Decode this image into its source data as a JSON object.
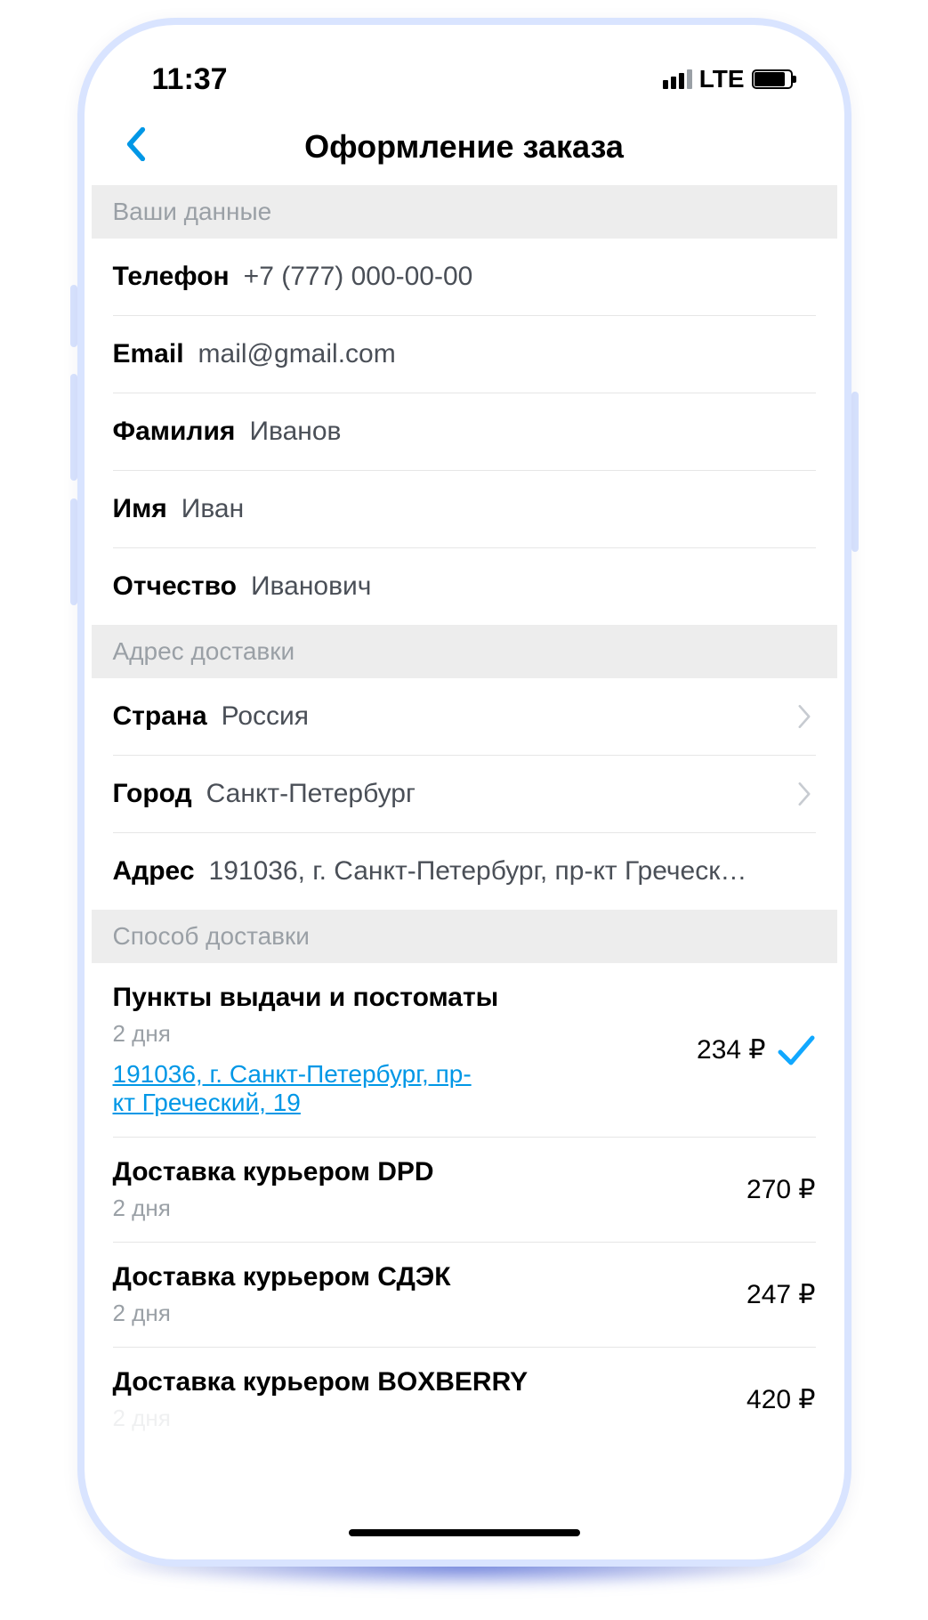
{
  "status": {
    "time": "11:37",
    "network": "LTE"
  },
  "nav": {
    "title": "Оформление заказа"
  },
  "sections": {
    "personal_header": "Ваши данные",
    "address_header": "Адрес доставки",
    "delivery_header": "Способ доставки"
  },
  "personal": {
    "phone_label": "Телефон",
    "phone_value": "+7 (777) 000-00-00",
    "email_label": "Email",
    "email_value": "mail@gmail.com",
    "last_label": "Фамилия",
    "last_value": "Иванов",
    "first_label": "Имя",
    "first_value": "Иван",
    "patr_label": "Отчество",
    "patr_value": "Иванович"
  },
  "address": {
    "country_label": "Страна",
    "country_value": "Россия",
    "city_label": "Город",
    "city_value": "Санкт-Петербург",
    "addr_label": "Адрес",
    "addr_value": "191036, г. Санкт-Петербург, пр-кт Греческ…"
  },
  "delivery": {
    "opt1_title": "Пункты выдачи и постоматы",
    "opt1_sub": "2 дня",
    "opt1_link": "191036, г. Санкт-Петербург, пр-кт Греческий, 19",
    "opt1_price": "234 ₽",
    "opt2_title": "Доставка курьером DPD",
    "opt2_sub": "2 дня",
    "opt2_price": "270 ₽",
    "opt3_title": "Доставка курьером СДЭК",
    "opt3_sub": "2 дня",
    "opt3_price": "247 ₽",
    "opt4_title": "Доставка курьером BOXBERRY",
    "opt4_sub": "2 дня",
    "opt4_price": "420 ₽"
  }
}
